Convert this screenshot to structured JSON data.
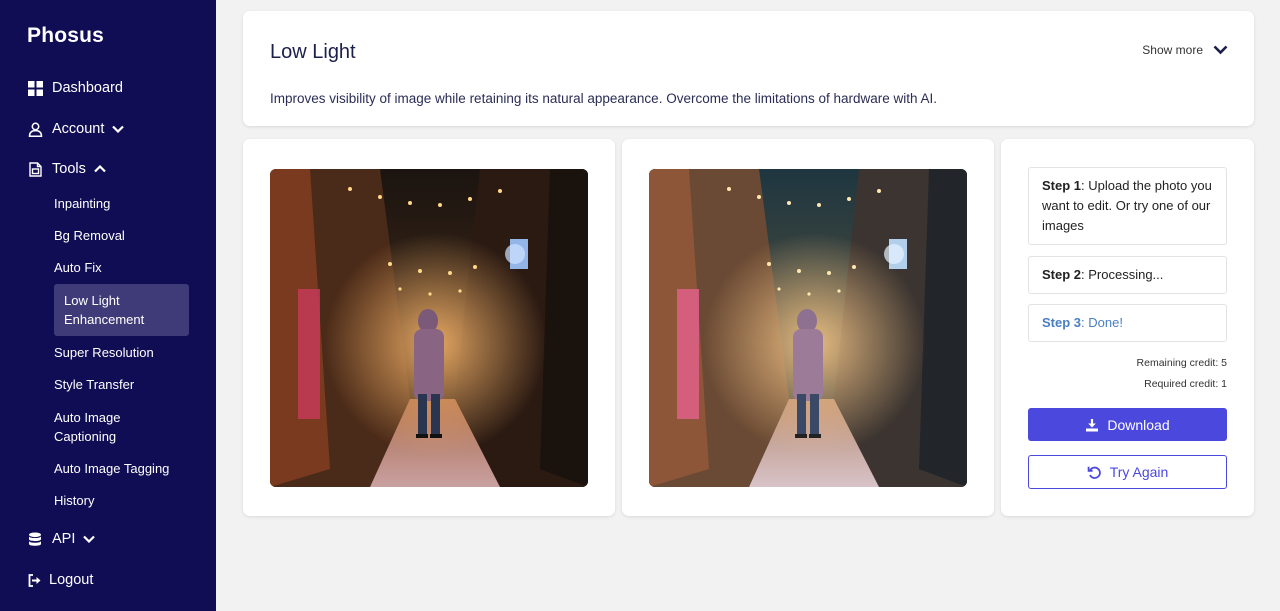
{
  "brand": {
    "logo": "Phosus"
  },
  "sidebar": {
    "dashboard": "Dashboard",
    "account": "Account",
    "tools": "Tools",
    "tools_items": [
      "Inpainting",
      "Bg Removal",
      "Auto Fix",
      "Low Light Enhancement",
      "Super Resolution",
      "Style Transfer",
      "Auto Image Captioning",
      "Auto Image Tagging",
      "History"
    ],
    "active_item": "Low Light Enhancement",
    "api": "API",
    "logout": "Logout"
  },
  "header": {
    "title": "Low Light",
    "description": "Improves visibility of image while retaining its natural appearance. Overcome the limitations of hardware with AI.",
    "show_more": "Show more"
  },
  "steps": {
    "step1_label": "Step 1",
    "step1_text": ": Upload the photo you want to edit. Or try one of our images",
    "step2_label": "Step 2",
    "step2_text": ": Processing...",
    "step3_label": "Step 3",
    "step3_text": ": Done!",
    "remaining_credit": "Remaining credit: 5",
    "required_credit": "Required credit: 1",
    "download": "Download",
    "try_again": "Try Again"
  },
  "colors": {
    "sidebar_bg": "#100d54",
    "active_item_bg": "#3e3b78",
    "primary": "#4b48de",
    "step_done": "#4a7fc1"
  },
  "icons": {
    "dashboard": "grid-icon",
    "account": "user-icon",
    "tools": "file-icon",
    "api": "database-icon",
    "logout": "logout-icon",
    "download": "download-icon",
    "try_again": "undo-icon"
  }
}
